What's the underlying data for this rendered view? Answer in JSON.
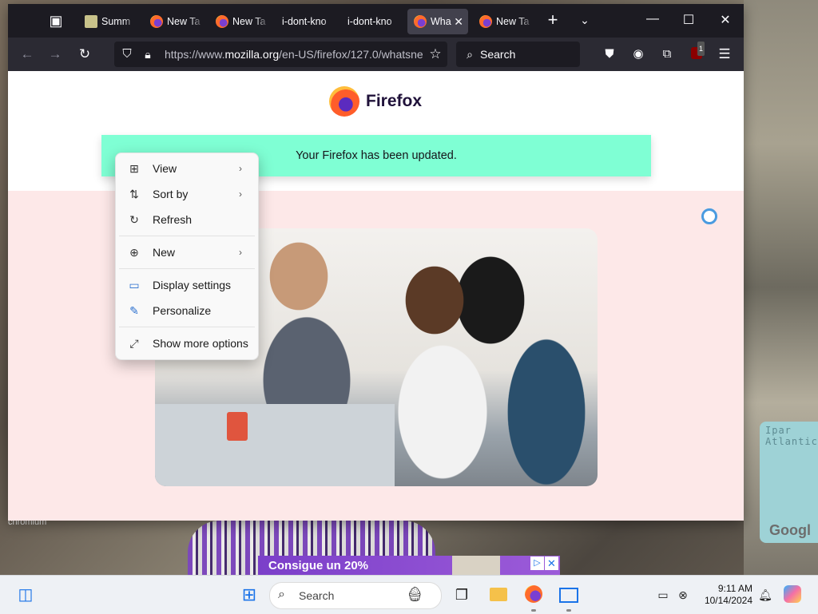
{
  "browser": {
    "tabs": [
      {
        "label": "Summ",
        "favicon": "document-icon",
        "active": false
      },
      {
        "label": "New Ta",
        "favicon": "firefox-icon",
        "active": false
      },
      {
        "label": "New Ta",
        "favicon": "firefox-icon",
        "active": false
      },
      {
        "label": "i-dont-kno",
        "favicon": "none",
        "active": false
      },
      {
        "label": "i-dont-kno",
        "favicon": "none",
        "active": false
      },
      {
        "label": "Wha",
        "favicon": "firefox-icon",
        "active": true
      },
      {
        "label": "New Ta",
        "favicon": "firefox-icon",
        "active": false
      }
    ],
    "url_prefix": "https://www.",
    "url_domain": "mozilla.org",
    "url_path": "/en-US/firefox/127.0/whatsne",
    "search_placeholder": "Search",
    "extension_badge": "1"
  },
  "page": {
    "brand": "Firefox",
    "banner_text": "Your Firefox has been updated."
  },
  "context_menu": {
    "items": [
      {
        "label": "View",
        "icon": "grid-icon",
        "submenu": true
      },
      {
        "label": "Sort by",
        "icon": "sort-icon",
        "submenu": true
      },
      {
        "label": "Refresh",
        "icon": "refresh-icon",
        "submenu": false
      },
      {
        "label": "New",
        "icon": "plus-circle-icon",
        "submenu": true
      },
      {
        "label": "Display settings",
        "icon": "display-settings-icon",
        "submenu": false
      },
      {
        "label": "Personalize",
        "icon": "brush-icon",
        "submenu": false
      },
      {
        "label": "Show more options",
        "icon": "expand-icon",
        "submenu": false
      }
    ]
  },
  "desktop": {
    "chromium_label": "chromium",
    "map_label_1": "Ipar",
    "map_label_2": "Atlantic",
    "google_label": "Googl",
    "ad_text": "Consigue un 20%"
  },
  "taskbar": {
    "search_label": "Search",
    "time": "9:11 AM",
    "date": "10/14/2024"
  },
  "colors": {
    "banner": "#7fffd4",
    "pink_section": "#fde8e8",
    "tab_bar": "#1c1b22"
  }
}
